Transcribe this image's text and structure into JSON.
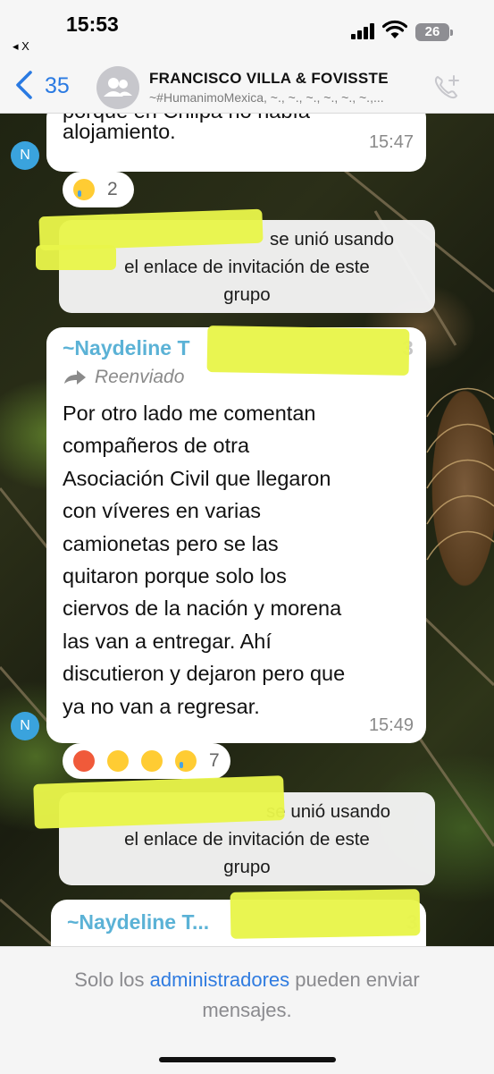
{
  "status_bar": {
    "time": "15:53",
    "back_app": "◂ X",
    "battery": "26"
  },
  "header": {
    "back_count": "35",
    "group_name": "FRANCISCO VILLA & FOVISSTE",
    "members": "~#HumanimoMexica, ~., ~., ~., ~., ~., ~.,..."
  },
  "messages": {
    "m1": {
      "text_top": "porque en Chilpa no había",
      "text_last": "alojamiento.",
      "time": "15:47",
      "avatar": "N",
      "reaction_count": "2"
    },
    "s1": {
      "suffix": "se unió usando",
      "line2": "el enlace de invitación de este",
      "line3": "grupo"
    },
    "m2": {
      "sender": "~Naydeline T",
      "sender_tail": "3",
      "forwarded": "Reenviado",
      "lines": [
        "Por otro lado me comentan",
        "compañeros de otra",
        "Asociación Civil que llegaron",
        "con víveres en varias",
        "camionetas pero se las",
        "quitaron porque solo los",
        "ciervos de la nación y morena",
        "las van a entregar. Ahí",
        "discutieron y dejaron pero que",
        "ya no van a regresar."
      ],
      "time": "15:49",
      "avatar": "N",
      "reaction_count": "7"
    },
    "s2": {
      "suffix": "se unió usando",
      "line2": "el enlace de invitación de este",
      "line3": "grupo"
    },
    "m3": {
      "sender": "~Naydeline T...",
      "sender_tail": "3"
    }
  },
  "footer": {
    "text_before": "Solo los ",
    "link": "administradores",
    "text_after": " pueden enviar",
    "line2": "mensajes."
  },
  "colors": {
    "accent": "#2a7ae2",
    "sender": "#5bb2d6",
    "highlight": "#e8f54a",
    "avatar": "#3aa3dd"
  }
}
